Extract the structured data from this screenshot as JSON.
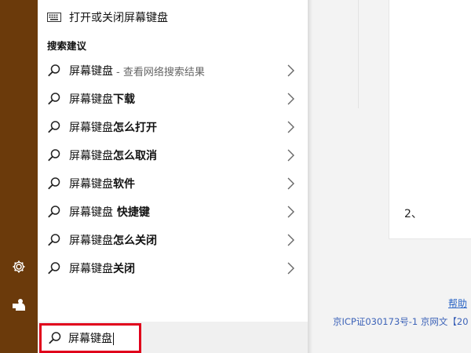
{
  "top_action": {
    "label": "打开或关闭屏幕键盘"
  },
  "section_title": "搜索建议",
  "suggestions": [
    {
      "prefix": "屏幕键盘",
      "suffix": "",
      "hint": "- 查看网络搜索结果"
    },
    {
      "prefix": "屏幕键盘",
      "suffix": "下载",
      "hint": ""
    },
    {
      "prefix": "屏幕键盘",
      "suffix": "怎么打开",
      "hint": ""
    },
    {
      "prefix": "屏幕键盘",
      "suffix": "怎么取消",
      "hint": ""
    },
    {
      "prefix": "屏幕键盘",
      "suffix": "软件",
      "hint": ""
    },
    {
      "prefix": "屏幕键盘",
      "suffix": " 快捷键",
      "hint": ""
    },
    {
      "prefix": "屏幕键盘",
      "suffix": "怎么关闭",
      "hint": ""
    },
    {
      "prefix": "屏幕键盘",
      "suffix": "关闭",
      "hint": ""
    }
  ],
  "search": {
    "value": "屏幕键盘"
  },
  "rail": {
    "icons": [
      "gear-icon",
      "user-icon"
    ]
  },
  "background": {
    "step_number": "2、",
    "help_link": "帮助",
    "footer_text": "京ICP证030173号-1   京网文【20"
  },
  "colors": {
    "rail": "#6b3a0b",
    "highlight_border": "#e0001b",
    "link": "#2a64c5"
  }
}
